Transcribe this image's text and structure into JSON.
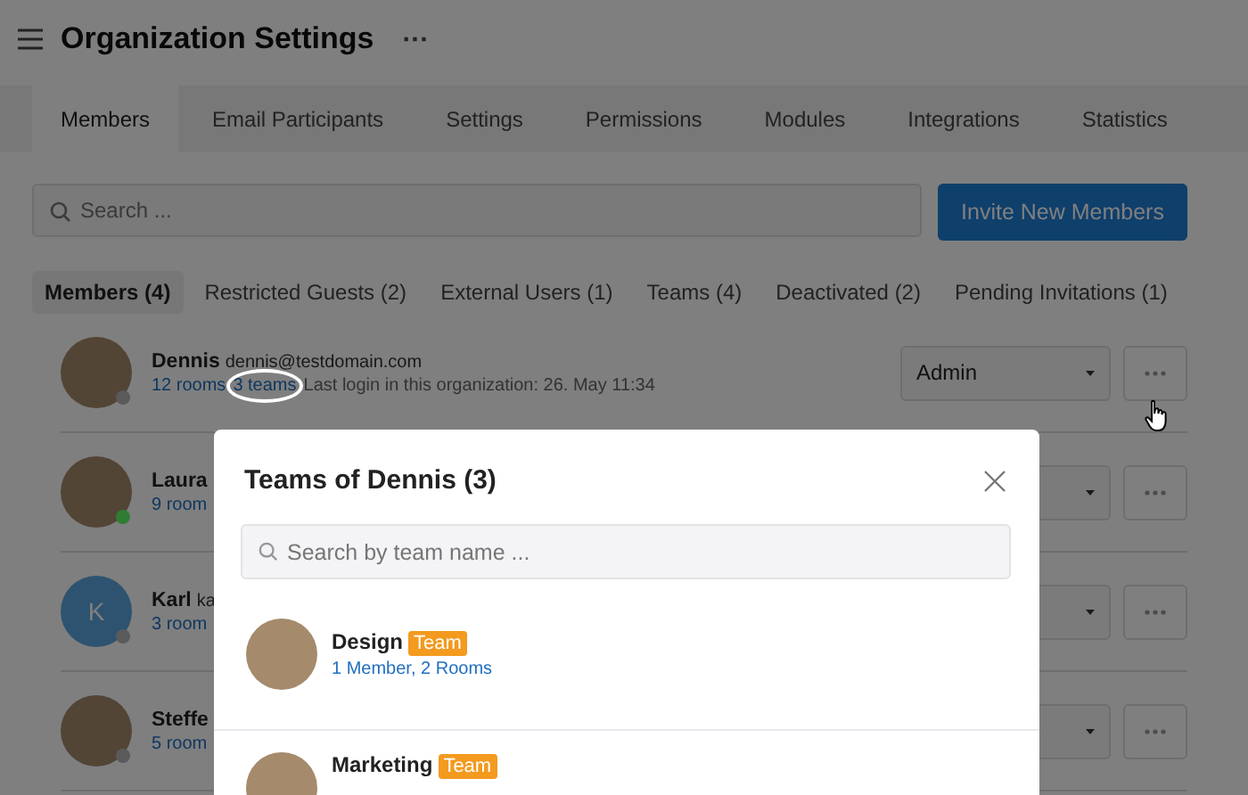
{
  "header": {
    "title": "Organization Settings",
    "more": "···"
  },
  "tabs": [
    {
      "label": "Members",
      "selected": true
    },
    {
      "label": "Email Participants",
      "selected": false
    },
    {
      "label": "Settings",
      "selected": false
    },
    {
      "label": "Permissions",
      "selected": false
    },
    {
      "label": "Modules",
      "selected": false
    },
    {
      "label": "Integrations",
      "selected": false
    },
    {
      "label": "Statistics",
      "selected": false
    }
  ],
  "search": {
    "placeholder": "Search ..."
  },
  "invite_button": "Invite New Members",
  "filters": [
    {
      "label": "Members (4)",
      "selected": true
    },
    {
      "label": "Restricted Guests (2)",
      "selected": false
    },
    {
      "label": "External Users (1)",
      "selected": false
    },
    {
      "label": "Teams (4)",
      "selected": false
    },
    {
      "label": "Deactivated (2)",
      "selected": false
    },
    {
      "label": "Pending Invitations (1)",
      "selected": false
    }
  ],
  "members": [
    {
      "name": "Dennis",
      "email": "dennis@testdomain.com",
      "rooms": "12 rooms",
      "teams": "3 teams",
      "login": "Last login in this organization: 26. May 11:34",
      "role": "Admin",
      "color": "#5a5a5a",
      "highlighted": true
    },
    {
      "name": "Laura",
      "rooms": "9 room",
      "color": "#2e7d32",
      "highlighted": false
    },
    {
      "name": "Karl",
      "email": "ka",
      "rooms": "3 room",
      "initial": "K",
      "color": "#5a5a5a",
      "highlighted": false
    },
    {
      "name": "Steffe",
      "rooms": "5 room",
      "color": "#5a5a5a",
      "highlighted": false
    }
  ],
  "dialog": {
    "title": "Teams of Dennis (3)",
    "search_placeholder": "Search by team name ...",
    "teams": [
      {
        "name": "Design",
        "badge": "Team",
        "details": "1 Member, 2 Rooms"
      },
      {
        "name": "Marketing",
        "badge": "Team"
      }
    ]
  }
}
